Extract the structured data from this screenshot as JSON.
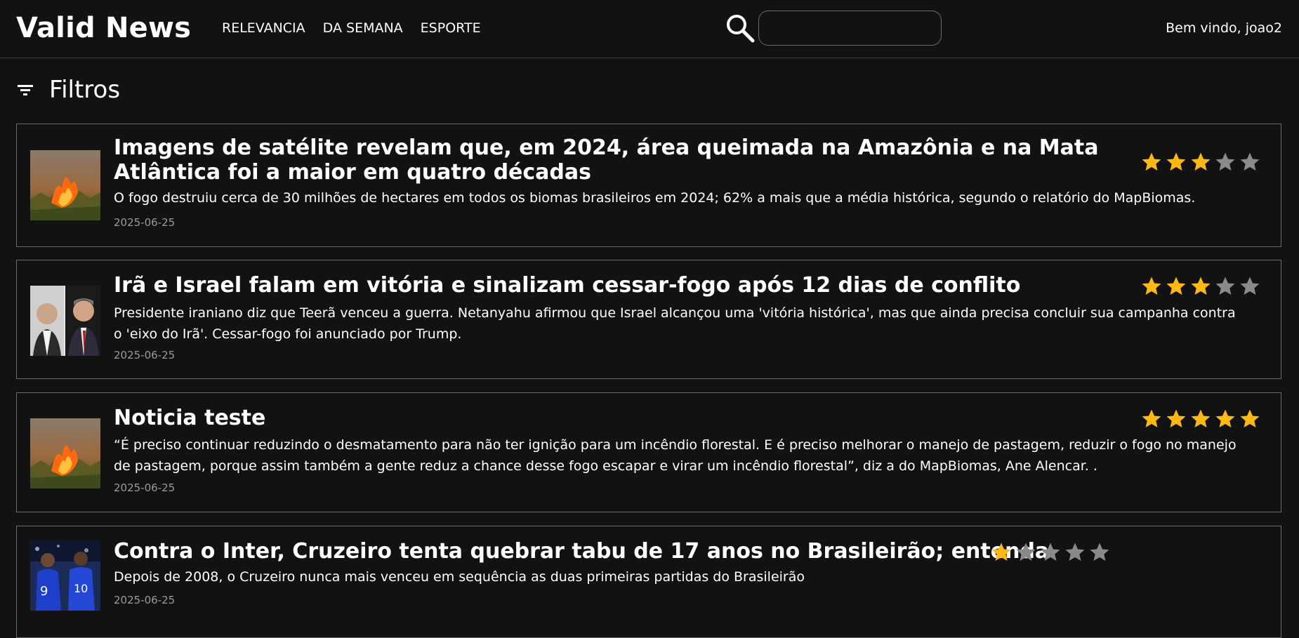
{
  "header": {
    "brand": "Valid News",
    "nav": [
      "RELEVANCIA",
      "DA SEMANA",
      "ESPORTE"
    ],
    "search_placeholder": "",
    "welcome": "Bem vindo, joao2"
  },
  "filters": {
    "label": "Filtros"
  },
  "colors": {
    "background": "#121212",
    "star_filled": "#FDB813",
    "star_empty": "#8a8a8a",
    "date_text": "#9a9a9a"
  },
  "news": [
    {
      "title": "Imagens de satélite revelam que, em 2024, área queimada na Amazônia e na Mata Atlântica foi a maior em quatro décadas",
      "summary": "O fogo destruiu cerca de 30 milhões de hectares em todos os biomas brasileiros em 2024; 62% a mais que a média histórica, segundo o relatório do MapBiomas.",
      "date": "2025-06-25",
      "rating": 3,
      "rating_max": 5,
      "thumbnail_icon": "wildfire-thumbnail"
    },
    {
      "title": "Irã e Israel falam em vitória e sinalizam cessar-fogo após 12 dias de conflito",
      "summary": "Presidente iraniano diz que Teerã venceu a guerra. Netanyahu afirmou que Israel alcançou uma 'vitória histórica', mas que ainda precisa concluir sua campanha contra o 'eixo do Irã'. Cessar-fogo foi anunciado por Trump.",
      "date": "2025-06-25",
      "rating": 3,
      "rating_max": 5,
      "thumbnail_icon": "leaders-portrait-thumbnail"
    },
    {
      "title": "Noticia teste",
      "summary": "“É preciso continuar reduzindo o desmatamento para não ter ignição para um incêndio florestal. E é preciso melhorar o manejo de pastagem, reduzir o fogo no manejo de pastagem, porque assim também a gente reduz a chance desse fogo escapar e virar um incêndio florestal”, diz a do MapBiomas, Ane Alencar. .",
      "date": "2025-06-25",
      "rating": 5,
      "rating_max": 5,
      "thumbnail_icon": "wildfire-thumbnail"
    },
    {
      "title": "Contra o Inter, Cruzeiro tenta quebrar tabu de 17 anos no Brasileirão; entenda",
      "summary": "Depois de 2008, o Cruzeiro nunca mais venceu em sequência as duas primeiras partidas do Brasileirão",
      "date": "2025-06-25",
      "rating": 1,
      "rating_max": 5,
      "thumbnail_icon": "football-players-thumbnail"
    }
  ]
}
